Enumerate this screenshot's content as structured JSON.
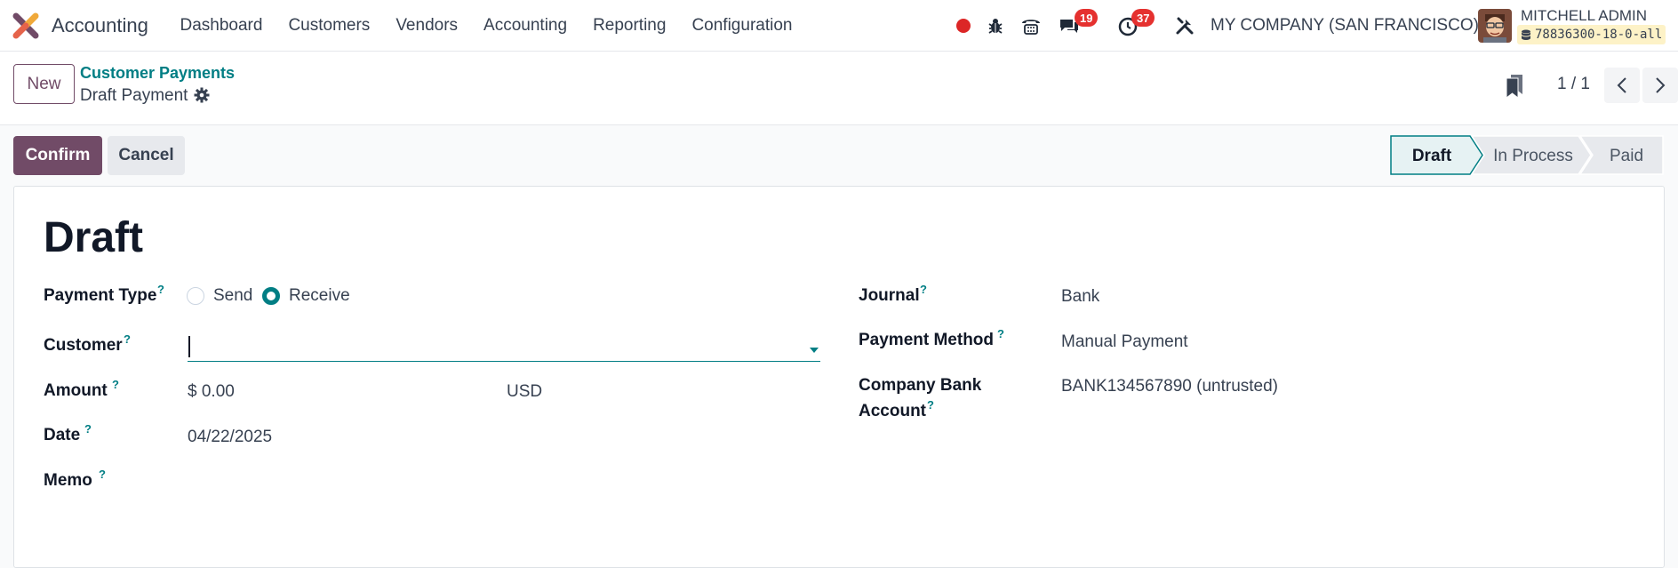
{
  "navbar": {
    "app_name": "Accounting",
    "menu": [
      "Dashboard",
      "Customers",
      "Vendors",
      "Accounting",
      "Reporting",
      "Configuration"
    ],
    "messages_count": "19",
    "activities_count": "37",
    "company": "MY COMPANY (SAN FRANCISCO)",
    "user_name": "MITCHELL ADMIN",
    "database": "78836300-18-0-all"
  },
  "control_panel": {
    "new_label": "New",
    "breadcrumb_parent": "Customer Payments",
    "breadcrumb_current": "Draft Payment",
    "pager": "1 / 1"
  },
  "statusbar": {
    "confirm_label": "Confirm",
    "cancel_label": "Cancel",
    "stages": [
      "Draft",
      "In Process",
      "Paid"
    ],
    "active_stage": "Draft"
  },
  "form": {
    "title": "Draft",
    "help_mark": "?",
    "payment_type": {
      "label": "Payment Type",
      "options": [
        "Send",
        "Receive"
      ],
      "selected": "Receive"
    },
    "customer": {
      "label": "Customer",
      "value": ""
    },
    "amount": {
      "label": "Amount",
      "value": "$ 0.00",
      "currency": "USD"
    },
    "date": {
      "label": "Date",
      "value": "04/22/2025"
    },
    "memo": {
      "label": "Memo",
      "value": ""
    },
    "journal": {
      "label": "Journal",
      "value": "Bank"
    },
    "payment_method": {
      "label": "Payment Method",
      "value": "Manual Payment"
    },
    "company_bank_account": {
      "label_line1": "Company Bank",
      "label_line2": "Account",
      "value": "BANK134567890 (untrusted)"
    }
  },
  "colors": {
    "brand": "#714b67",
    "accent": "#017e84",
    "badge": "#e5312f",
    "record_dot": "#dc2626"
  }
}
